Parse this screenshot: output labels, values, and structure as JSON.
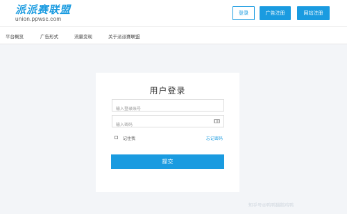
{
  "header": {
    "logo_text": "派派赛联盟",
    "logo_domain": "union.ppwsc.com",
    "login_label": "登录",
    "ad_register_label": "广告注册",
    "site_register_label": "网站注册"
  },
  "nav": {
    "items": [
      "平台概览",
      "广告形式",
      "流量变现",
      "关于派派赛联盟"
    ]
  },
  "login": {
    "title": "用户登录",
    "account_placeholder": "输入登录账号",
    "password_placeholder": "输入密码",
    "remember_label": "记住我",
    "forgot_label": "忘记密码",
    "submit_label": "提交"
  },
  "watermark": {
    "text": "知乎号@鸭鸭猫鹅鸡鸭"
  },
  "colors": {
    "accent": "#1a9be0",
    "background": "#f3f5f8"
  }
}
